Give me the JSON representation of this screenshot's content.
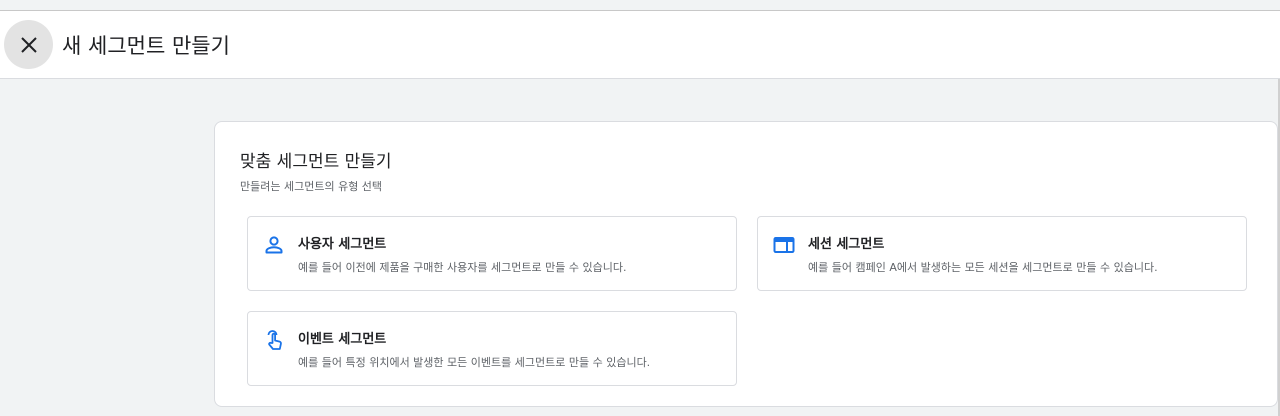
{
  "header": {
    "title": "새 세그먼트 만들기",
    "close_icon": "close-icon"
  },
  "card": {
    "title": "맞춤 세그먼트 만들기",
    "subtitle": "만들려는 세그먼트의 유형 선택"
  },
  "options": [
    {
      "icon": "person-icon",
      "title": "사용자 세그먼트",
      "description": "예를 들어 이전에 제품을 구매한 사용자를 세그먼트로 만들 수 있습니다."
    },
    {
      "icon": "session-window-icon",
      "title": "세션 세그먼트",
      "description": "예를 들어 캠페인 A에서 발생하는 모든 세션을 세그먼트로 만들 수 있습니다."
    },
    {
      "icon": "touch-hand-icon",
      "title": "이벤트 세그먼트",
      "description": "예를 들어 특정 위치에서 발생한 모든 이벤트를 세그먼트로 만들 수 있습니다."
    }
  ],
  "colors": {
    "accent": "#1a73e8",
    "text_primary": "#202124",
    "text_secondary": "#5f6368",
    "border": "#dadce0",
    "page_background": "#f1f3f4"
  }
}
